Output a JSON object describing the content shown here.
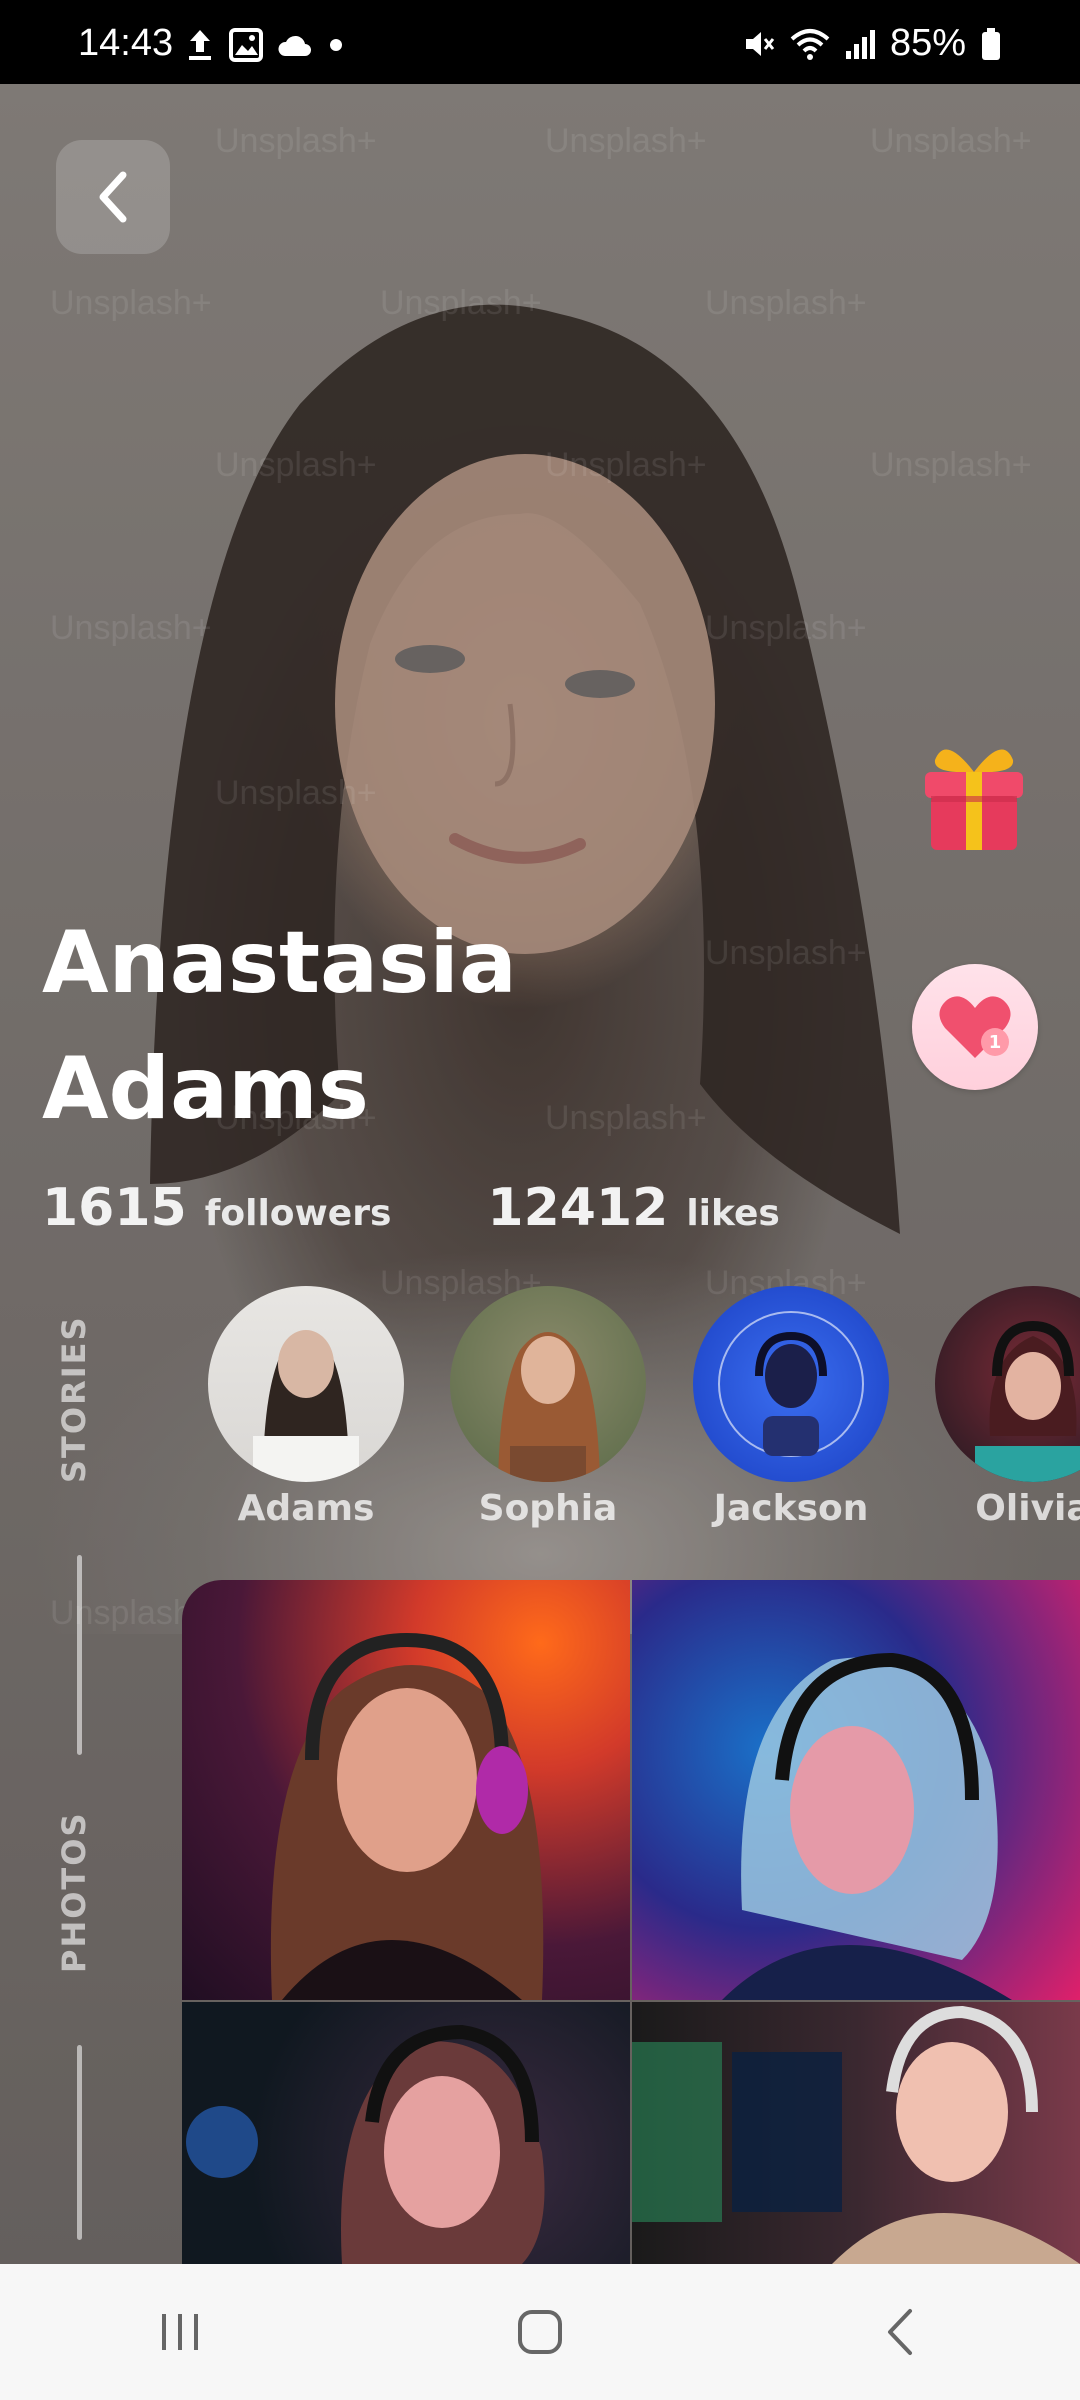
{
  "status_bar": {
    "time": "14:43",
    "battery": "85%",
    "left_icons": [
      "upload-icon",
      "image-icon",
      "cloud-icon",
      "dot-icon"
    ],
    "right_icons": [
      "mute-icon",
      "wifi-icon",
      "signal-icon",
      "battery-icon"
    ]
  },
  "profile": {
    "first_name": "Anastasia",
    "last_name": "Adams",
    "followers_count": "1615",
    "followers_label": "followers",
    "likes_count": "12412",
    "likes_label": "likes"
  },
  "side_labels": {
    "stories": "STORIES",
    "photos": "PHOTOS"
  },
  "watermark_text": "Unsplash+",
  "stories": [
    {
      "name": "Adams"
    },
    {
      "name": "Sophia"
    },
    {
      "name": "Jackson"
    },
    {
      "name": "Olivia"
    }
  ],
  "actions": {
    "gift_icon": "gift-icon",
    "heart_icon": "heart-icon",
    "heart_badge": "1"
  },
  "colors": {
    "heart_bg": "#ffd6e0",
    "heart": "#f0506e",
    "accent_blue": "#1d4ed8"
  }
}
